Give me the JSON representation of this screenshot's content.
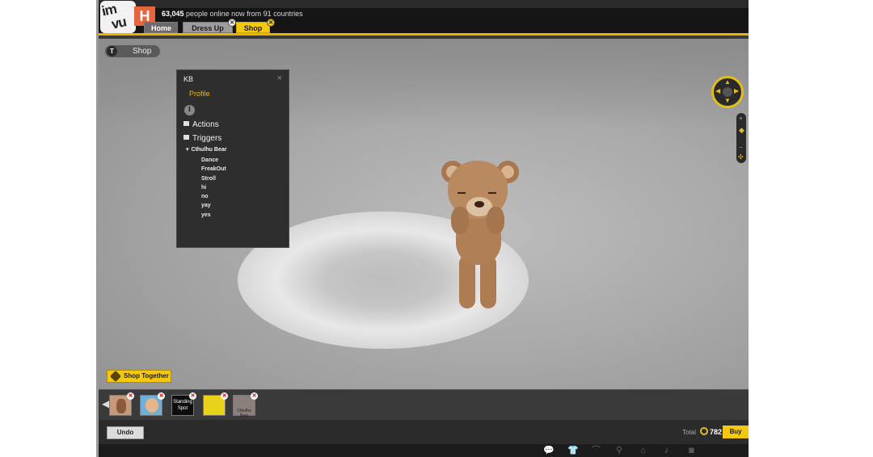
{
  "header": {
    "logo_text_top": "im",
    "logo_text_bottom": "vu",
    "badge_letter": "H",
    "online_count": "63,045",
    "online_suffix": " people online now from 91 countries",
    "tabs": [
      {
        "label": "Home"
      },
      {
        "label": "Dress Up"
      },
      {
        "label": "Shop"
      }
    ],
    "tab_close_glyph": "✕",
    "accent_color": "#f3c80e"
  },
  "viewport": {
    "mode_pill_label": "Shop",
    "mode_pill_icon": "T"
  },
  "panel": {
    "title": "KB",
    "close_glyph": "×",
    "profile_label": "Profile",
    "info_glyph": "i",
    "actions_label": "Actions",
    "triggers_label": "Triggers",
    "group_label": "Cthulhu Bear",
    "triggers": [
      "Dance",
      "FreakOut",
      "Stroll",
      "hi",
      "no",
      "yay",
      "yes"
    ]
  },
  "nav": {
    "up": "▲",
    "down": "▼",
    "left": "◀",
    "right": "▶",
    "zoom_in": "+",
    "zoom_out": "−",
    "zoom_handle": "◆",
    "fit": "✣"
  },
  "shop_together": {
    "label": "Shop Together"
  },
  "strip": {
    "prev_glyph": "◀",
    "remove_glyph": "✕",
    "items": [
      {
        "label": ""
      },
      {
        "label": ""
      },
      {
        "label": "Standing Spot"
      },
      {
        "label": ""
      },
      {
        "label": "Cthulhu Bear"
      }
    ]
  },
  "bottom": {
    "undo_label": "Undo",
    "total_label": "Total",
    "credits": "782",
    "buy_label": "Buy"
  },
  "footer_icons": [
    "chat-icon",
    "shirt-icon",
    "hanger-icon",
    "pose-icon",
    "home-icon",
    "music-icon",
    "camera-icon"
  ]
}
